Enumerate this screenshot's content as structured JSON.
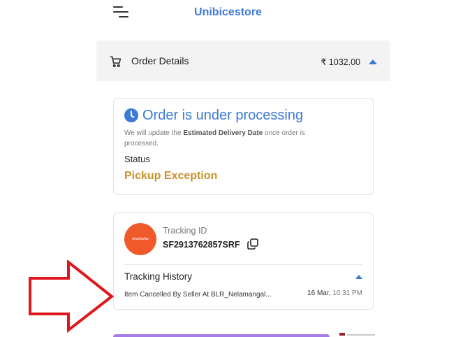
{
  "header": {
    "menu_icon": "hamburger-menu-icon",
    "store_name": "Unibicestore"
  },
  "order_bar": {
    "icon": "cart-icon",
    "label": "Order Details",
    "amount": "₹ 1032.00",
    "toggle_icon": "caret-up-icon"
  },
  "processing_card": {
    "icon": "clock-icon",
    "title": "Order is under processing",
    "note_prefix": "We will update the ",
    "note_bold": "Estimated Delivery Date",
    "note_suffix": " once order is processed.",
    "status_label": "Status",
    "status_value": "Pickup Exception",
    "status_color": "#c7922a"
  },
  "tracking_card": {
    "carrier_logo": "shadowfax-logo",
    "carrier_logo_text": "shadowfax",
    "tracking_id_label": "Tracking ID",
    "tracking_id": "SF2913762857SRF",
    "copy_icon": "copy-icon",
    "history_title": "Tracking History",
    "history_toggle_icon": "caret-up-icon",
    "events": [
      {
        "description": "Item Cancelled By Seller At BLR_Nelamangal...",
        "date": "16 Mar,",
        "time": "10:31 PM"
      }
    ]
  },
  "annotation": {
    "icon": "red-arrow-icon",
    "color": "#e0161d"
  },
  "colors": {
    "accent": "#3d7ad6",
    "status": "#c7922a",
    "bar_bg": "#f3f3f3"
  }
}
